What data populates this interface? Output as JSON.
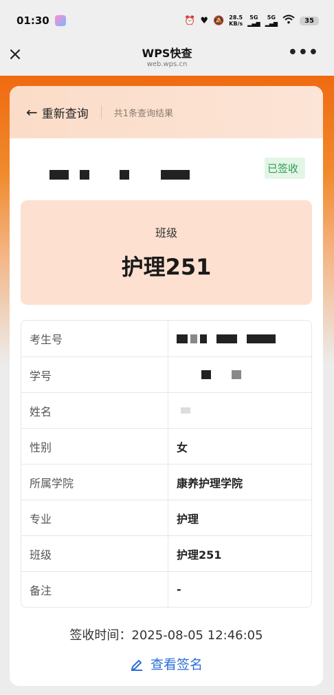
{
  "status_bar": {
    "time": "01:30",
    "net_speed": "28.5",
    "net_unit": "KB/s",
    "signal1": "5G",
    "signal2": "5G",
    "battery": "35"
  },
  "nav": {
    "title": "WPS快查",
    "subtitle": "web.wps.cn",
    "close_icon": "×",
    "more_icon": "•••"
  },
  "header": {
    "back_label": "重新查询",
    "result_count": "共1条查询结果"
  },
  "status_badge": "已签收",
  "class_box": {
    "label": "班级",
    "value": "护理251"
  },
  "info": [
    {
      "key": "考生号",
      "value": ""
    },
    {
      "key": "学号",
      "value": ""
    },
    {
      "key": "姓名",
      "value": ""
    },
    {
      "key": "性别",
      "value": "女"
    },
    {
      "key": "所属学院",
      "value": "康养护理学院"
    },
    {
      "key": "专业",
      "value": "护理"
    },
    {
      "key": "班级",
      "value": "护理251"
    },
    {
      "key": "备注",
      "value": "-"
    }
  ],
  "sign_time_label": "签收时间：",
  "sign_time_value": "2025-08-05 12:46:05",
  "view_sign_label": "查看签名",
  "colors": {
    "accent_orange": "#f06a10",
    "link_blue": "#2b6fd6",
    "badge_green": "#2f9a52"
  }
}
